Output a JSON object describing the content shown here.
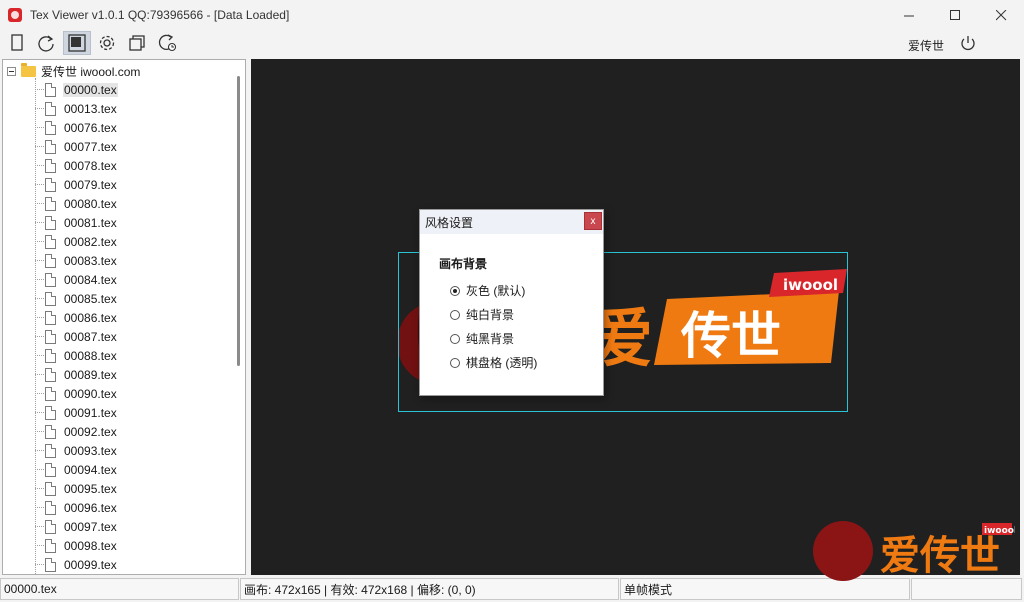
{
  "window": {
    "title": "Tex Viewer v1.0.1 QQ:79396566 - [Data Loaded]"
  },
  "toolbar": {
    "user_label": "爱传世",
    "buttons": [
      "new-file-icon",
      "refresh-icon",
      "canvas-background-icon",
      "settings-gear-icon",
      "copy-window-icon",
      "reload-history-icon"
    ]
  },
  "tree": {
    "root_label": "爱传世 iwoool.com",
    "selected": "00000.tex",
    "files": [
      "00000.tex",
      "00013.tex",
      "00076.tex",
      "00077.tex",
      "00078.tex",
      "00079.tex",
      "00080.tex",
      "00081.tex",
      "00082.tex",
      "00083.tex",
      "00084.tex",
      "00085.tex",
      "00086.tex",
      "00087.tex",
      "00088.tex",
      "00089.tex",
      "00090.tex",
      "00091.tex",
      "00092.tex",
      "00093.tex",
      "00094.tex",
      "00095.tex",
      "00096.tex",
      "00097.tex",
      "00098.tex",
      "00099.tex"
    ]
  },
  "preview": {
    "logo_badge": "iwoool",
    "logo_text": "传世",
    "logo_char": "爱"
  },
  "dialog": {
    "title": "风格设置",
    "close": "x",
    "section": "画布背景",
    "options": [
      {
        "label": "灰色 (默认)",
        "checked": true
      },
      {
        "label": "纯白背景",
        "checked": false
      },
      {
        "label": "纯黑背景",
        "checked": false
      },
      {
        "label": "棋盘格 (透明)",
        "checked": false
      }
    ]
  },
  "status": {
    "file": "00000.tex",
    "info": "画布: 472x165 | 有效: 472x168 | 偏移: (0, 0)",
    "mode": "单帧模式",
    "watermark_badge": "iwoool",
    "watermark_text": "爱传世"
  },
  "colors": {
    "accent_orange": "#f07a12",
    "badge_red": "#d8262b",
    "frame_cyan": "#28c4d6",
    "canvas_bg": "#202020"
  }
}
